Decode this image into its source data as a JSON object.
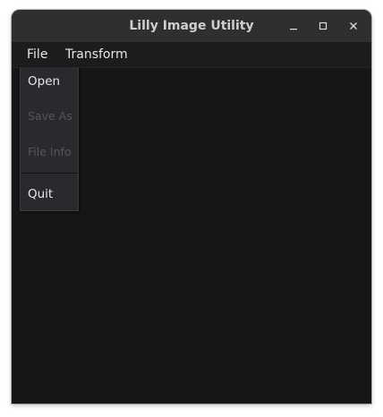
{
  "window": {
    "title": "Lilly Image Utility"
  },
  "menubar": {
    "items": [
      {
        "label": "File"
      },
      {
        "label": "Transform"
      }
    ]
  },
  "file_menu": {
    "items": [
      {
        "label": "Open",
        "enabled": true
      },
      {
        "label": "Save As",
        "enabled": false
      },
      {
        "label": "File Info",
        "enabled": false
      },
      {
        "label": "Quit",
        "enabled": true
      }
    ]
  },
  "icons": {
    "minimize": "minimize-icon",
    "maximize": "maximize-icon",
    "close": "close-icon"
  },
  "colors": {
    "titlebar_bg": "#2f2f2f",
    "window_bg": "#161616",
    "menu_bg": "#2a2a2e",
    "text": "#e6e6e6",
    "disabled_text": "#55555a"
  }
}
